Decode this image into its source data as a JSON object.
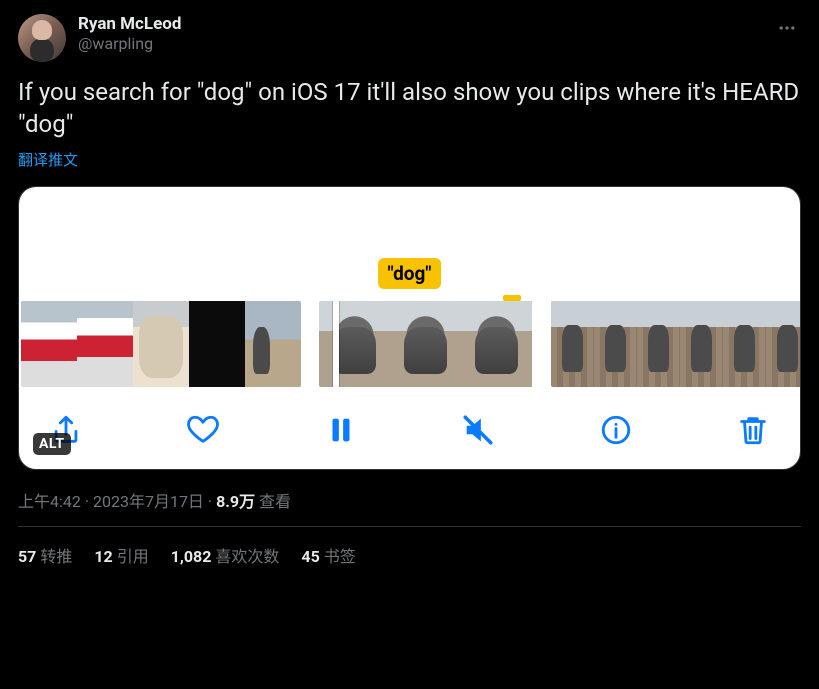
{
  "author": {
    "display_name": "Ryan McLeod",
    "handle": "@warpling"
  },
  "tweet_text": "If you search for \"dog\" on iOS 17 it'll also show you clips where it's HEARD \"dog\"",
  "translate_label": "翻译推文",
  "media": {
    "tooltip": "\"dog\"",
    "alt_badge": "ALT",
    "toolbar": {
      "share": "share",
      "like": "like",
      "pause": "pause",
      "mute": "mute",
      "info": "info",
      "delete": "delete"
    }
  },
  "meta": {
    "time": "上午4:42",
    "date": "2023年7月17日",
    "views_count": "8.9万",
    "views_label": "查看"
  },
  "stats": {
    "retweets_n": "57",
    "retweets_label": "转推",
    "quotes_n": "12",
    "quotes_label": "引用",
    "likes_n": "1,082",
    "likes_label": "喜欢次数",
    "bookmarks_n": "45",
    "bookmarks_label": "书签"
  }
}
